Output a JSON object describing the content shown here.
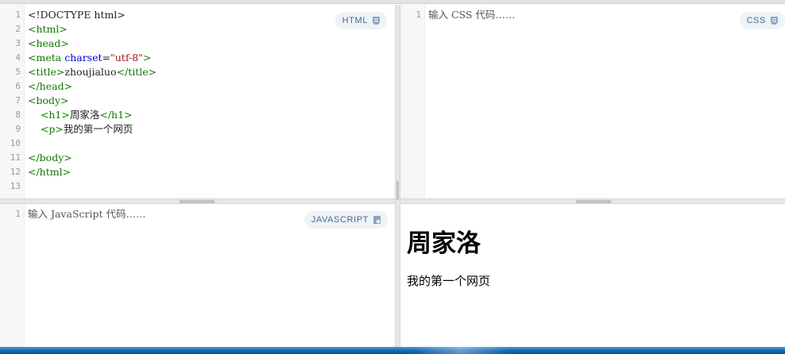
{
  "html_panel": {
    "badge": "HTML",
    "badge_icon": "html5-shield-icon",
    "line_numbers": [
      "1",
      "2",
      "3",
      "4",
      "5",
      "6",
      "7",
      "8",
      "9",
      "10",
      "11",
      "12",
      "13"
    ],
    "lines": [
      [
        {
          "cls": "txt",
          "text": "<!DOCTYPE html>"
        }
      ],
      [
        {
          "cls": "t",
          "text": "<html>"
        }
      ],
      [
        {
          "cls": "t",
          "text": "<head>"
        }
      ],
      [
        {
          "cls": "t",
          "text": "<meta "
        },
        {
          "cls": "a",
          "text": "charset"
        },
        {
          "cls": "txt",
          "text": "="
        },
        {
          "cls": "s",
          "text": "\"utf-8\""
        },
        {
          "cls": "t",
          "text": ">"
        }
      ],
      [
        {
          "cls": "t",
          "text": "<title>"
        },
        {
          "cls": "txt",
          "text": "zhoujialuo"
        },
        {
          "cls": "t",
          "text": "</title>"
        }
      ],
      [
        {
          "cls": "t",
          "text": "</head>"
        }
      ],
      [
        {
          "cls": "t",
          "text": "<body>"
        }
      ],
      [
        {
          "cls": "txt",
          "text": "    "
        },
        {
          "cls": "t",
          "text": "<h1>"
        },
        {
          "cls": "txt",
          "text": "周家洛"
        },
        {
          "cls": "t",
          "text": "</h1>"
        }
      ],
      [
        {
          "cls": "txt",
          "text": "    "
        },
        {
          "cls": "t",
          "text": "<p>"
        },
        {
          "cls": "txt",
          "text": "我的第一个网页"
        }
      ],
      [],
      [
        {
          "cls": "t",
          "text": "</body>"
        }
      ],
      [
        {
          "cls": "t",
          "text": "</html>"
        }
      ],
      []
    ]
  },
  "css_panel": {
    "badge": "CSS",
    "badge_icon": "css3-shield-icon",
    "line_numbers": [
      "1"
    ],
    "placeholder": "输入 CSS 代码……"
  },
  "js_panel": {
    "badge": "JAVASCRIPT",
    "badge_icon": "javascript-icon",
    "line_numbers": [
      "1"
    ],
    "placeholder": "输入 JavaScript 代码……"
  },
  "result_panel": {
    "heading": "周家洛",
    "paragraph": "我的第一个网页"
  },
  "colors": {
    "tag": "#117700",
    "attribute": "#0000cc",
    "string": "#aa1111",
    "badge_bg": "#eef3f8",
    "badge_text": "#4a6a8a",
    "taskbar": "#1d6db8"
  }
}
